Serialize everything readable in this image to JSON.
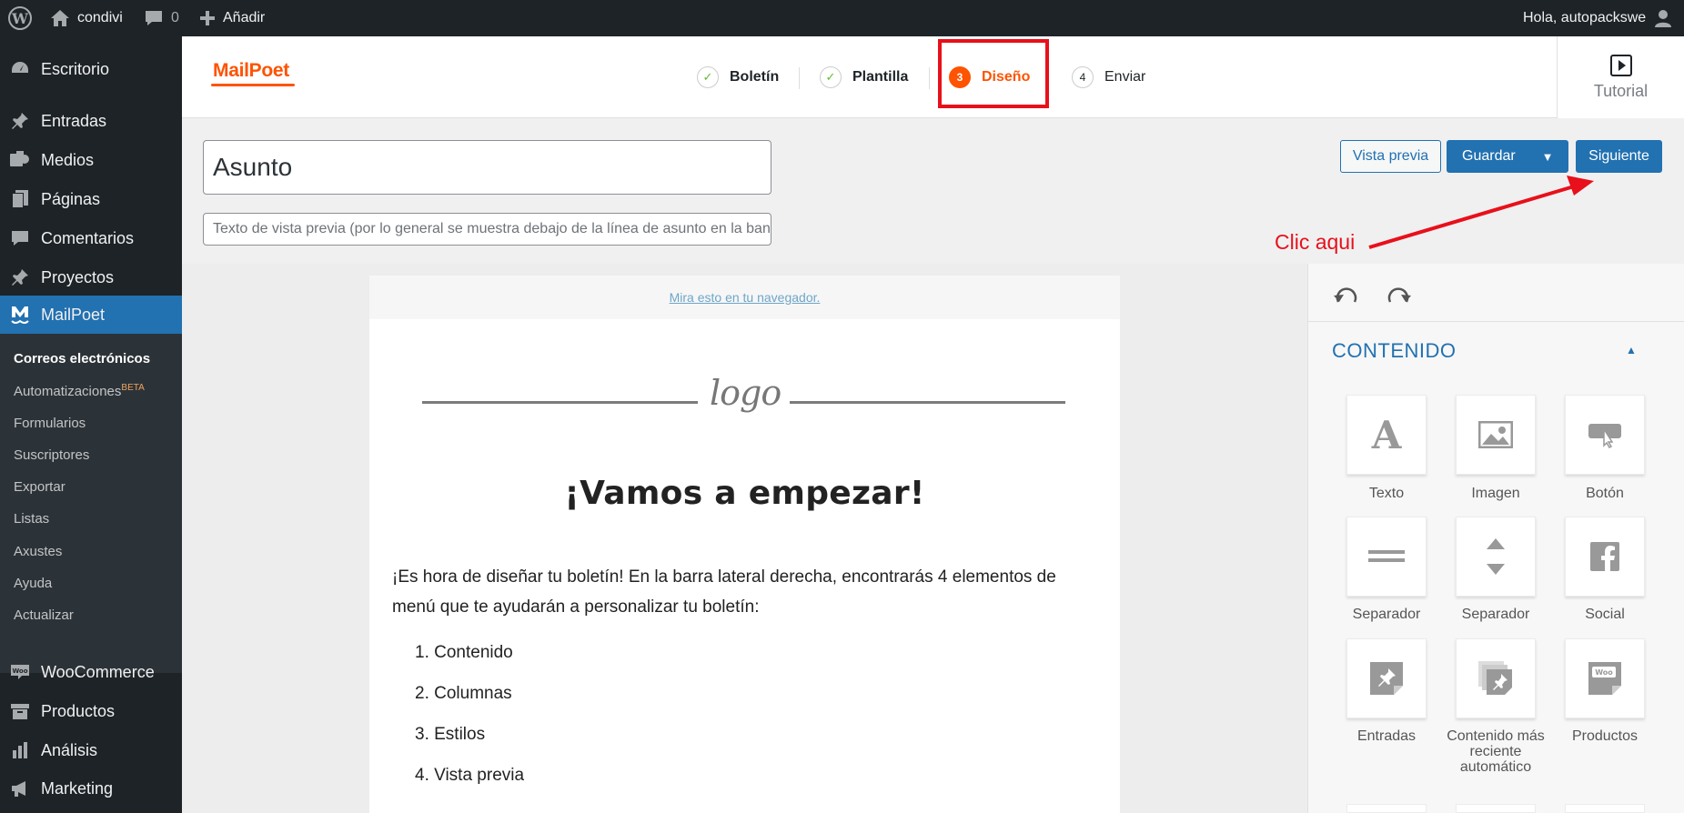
{
  "adminbar": {
    "site_name": "condivi",
    "comments_count": "0",
    "add_new": "Añadir",
    "greeting": "Hola, autopackswe"
  },
  "sidebar": {
    "items": [
      {
        "label": "Escritorio",
        "icon": "dashboard-icon"
      },
      {
        "label": "Entradas",
        "icon": "pushpin-icon"
      },
      {
        "label": "Medios",
        "icon": "media-icon"
      },
      {
        "label": "Páginas",
        "icon": "pages-icon"
      },
      {
        "label": "Comentarios",
        "icon": "comment-icon"
      },
      {
        "label": "Proyectos",
        "icon": "pushpin-icon"
      },
      {
        "label": "MailPoet",
        "icon": "mailpoet-icon"
      },
      {
        "label": "WooCommerce",
        "icon": "woo-icon"
      },
      {
        "label": "Productos",
        "icon": "archive-icon"
      },
      {
        "label": "Análisis",
        "icon": "chart-bar-icon"
      },
      {
        "label": "Marketing",
        "icon": "megaphone-icon"
      }
    ],
    "submenu": [
      {
        "label": "Correos electrónicos"
      },
      {
        "label": "Automatizaciones",
        "badge": "BETA"
      },
      {
        "label": "Formularios"
      },
      {
        "label": "Suscriptores"
      },
      {
        "label": "Exportar"
      },
      {
        "label": "Listas"
      },
      {
        "label": "Axustes"
      },
      {
        "label": "Ayuda"
      },
      {
        "label": "Actualizar"
      }
    ]
  },
  "header": {
    "logo_text": "MailPoet",
    "steps": [
      {
        "number": "✓",
        "label": "Boletín",
        "state": "done"
      },
      {
        "number": "✓",
        "label": "Plantilla",
        "state": "done"
      },
      {
        "number": "3",
        "label": "Diseño",
        "state": "current"
      },
      {
        "number": "4",
        "label": "Enviar",
        "state": "pending"
      }
    ],
    "tutorial_label": "Tutorial"
  },
  "form": {
    "subject_placeholder": "Asunto",
    "preheader_placeholder": "Texto de vista previa (por lo general se muestra debajo de la línea de asunto en la bandeja de entrada)"
  },
  "toolbar": {
    "preview_label": "Vista previa",
    "save_label": "Guardar",
    "next_label": "Siguiente"
  },
  "annotation": {
    "text": "Clic aqui"
  },
  "email": {
    "browser_link": "Mira esto en tu navegador.",
    "logo_text": "logo",
    "heading": "¡Vamos a empezar!",
    "intro": "¡Es hora de diseñar tu boletín! En la barra lateral derecha, encontrarás 4 elementos de menú que te ayudarán a personalizar tu boletín:",
    "list": [
      "1. Contenido",
      "2. Columnas",
      "3. Estilos",
      "4. Vista previa"
    ]
  },
  "panel": {
    "section_title": "CONTENIDO",
    "widgets": [
      {
        "label": "Texto",
        "icon": "text-icon"
      },
      {
        "label": "Imagen",
        "icon": "image-icon"
      },
      {
        "label": "Botón",
        "icon": "button-icon"
      },
      {
        "label": "Separador",
        "icon": "divider-icon"
      },
      {
        "label": "Separador",
        "icon": "spacer-icon"
      },
      {
        "label": "Social",
        "icon": "facebook-icon"
      },
      {
        "label": "Entradas",
        "icon": "posts-icon"
      },
      {
        "label": "Contenido más reciente automático",
        "icon": "auto-posts-icon"
      },
      {
        "label": "Productos",
        "icon": "products-icon"
      }
    ]
  },
  "colors": {
    "admin_dark": "#1d2327",
    "wp_blue": "#2271b1",
    "mailpoet_orange": "#fe5301",
    "annotation_red": "#e8101a"
  }
}
